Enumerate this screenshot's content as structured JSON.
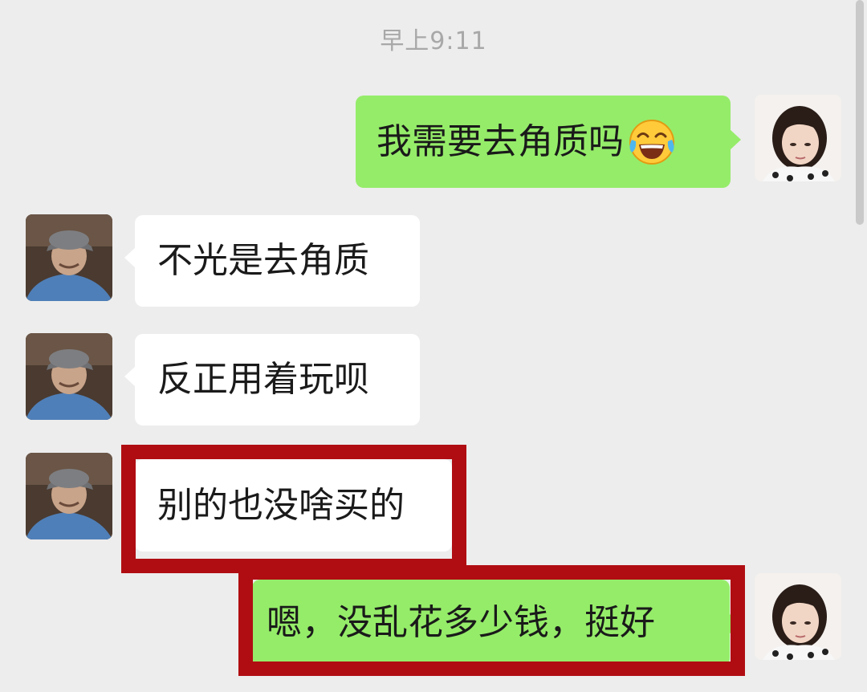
{
  "chat": {
    "timestamp": "早上9:11",
    "messages": [
      {
        "side": "right",
        "sender": "self",
        "text": "我需要去角质吗",
        "emoji": "tears-of-joy-emoji"
      },
      {
        "side": "left",
        "sender": "other",
        "text": "不光是去角质"
      },
      {
        "side": "left",
        "sender": "other",
        "text": "反正用着玩呗"
      },
      {
        "side": "left",
        "sender": "other",
        "text": "别的也没啥买的",
        "highlighted": true
      },
      {
        "side": "right",
        "sender": "self",
        "text": "嗯，没乱花多少钱，挺好",
        "highlighted": true
      }
    ]
  },
  "colors": {
    "background": "#ededed",
    "self_bubble": "#95ec69",
    "other_bubble": "#ffffff",
    "highlight_border": "#b00d12",
    "timestamp_text": "#a8a8a8"
  }
}
